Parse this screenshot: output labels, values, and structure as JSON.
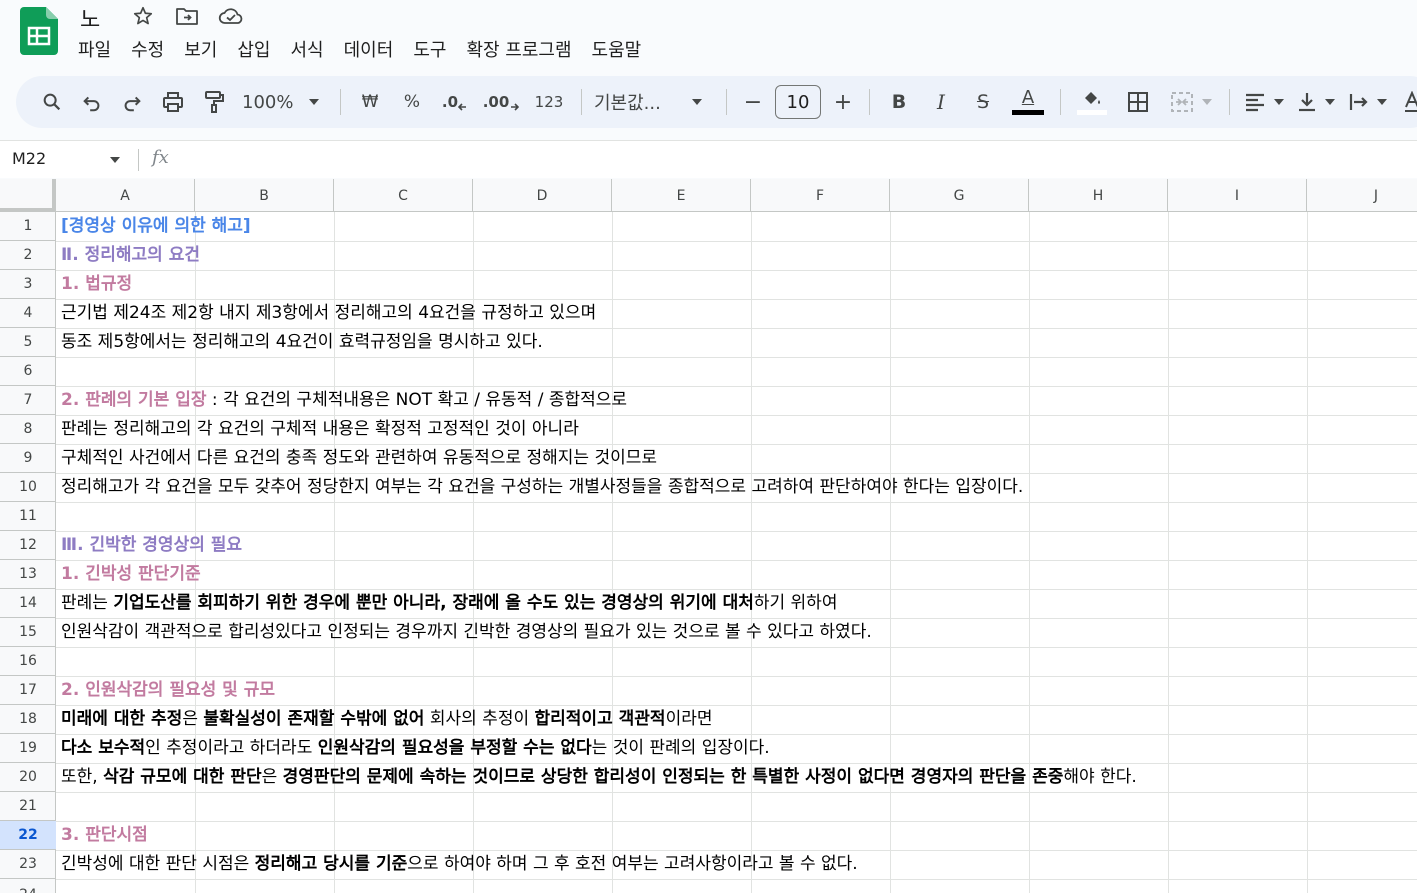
{
  "title_bar": {
    "doc_title": "노"
  },
  "menu": [
    "파일",
    "수정",
    "보기",
    "삽입",
    "서식",
    "데이터",
    "도구",
    "확장 프로그램",
    "도움말"
  ],
  "toolbar": {
    "zoom": "100%",
    "currency": "₩",
    "percent": "%",
    "decrease_decimal": ".0",
    "increase_decimal": ".00",
    "number_format": "123",
    "font_name": "기본값...",
    "font_size": "10",
    "minus": "−",
    "plus": "+",
    "bold": "B",
    "italic": "I",
    "strike": "S",
    "text_color": "A",
    "text_color_hex": "#000000"
  },
  "formula_bar": {
    "cell_ref": "M22",
    "fx": "fx"
  },
  "columns": [
    "A",
    "B",
    "C",
    "D",
    "E",
    "F",
    "G",
    "H",
    "I",
    "J"
  ],
  "rows": [
    "1",
    "2",
    "3",
    "4",
    "5",
    "6",
    "7",
    "8",
    "9",
    "10",
    "11",
    "12",
    "13",
    "14",
    "15",
    "16",
    "17",
    "18",
    "19",
    "20",
    "21",
    "22",
    "23",
    "24"
  ],
  "selected_row": "22",
  "colors": {
    "blue": "#4a86e8",
    "purple": "#8e7cc3",
    "pink": "#c27ba0",
    "accent": "#0b57d0"
  },
  "cells": {
    "r1": "[경영상 이유에 의한 해고]",
    "r2": "Ⅱ. 정리해고의 요건",
    "r3": "1. 법규정",
    "r4": "근기법 제24조 제2항 내지 제3항에서 정리해고의 4요건을 규정하고 있으며",
    "r5": "동조 제5항에서는 정리해고의 4요건이 효력규정임을 명시하고 있다.",
    "r7a": "2. 판례의 기본 입장",
    "r7b": " : 각 요건의 구체적내용은 NOT 확고 / 유동적 / 종합적으로",
    "r8": "판례는 정리해고의 각 요건의 구체적 내용은 확정적 고정적인 것이 아니라",
    "r9": "구체적인 사건에서 다른 요건의 충족 정도와 관련하여 유동적으로 정해지는 것이므로",
    "r10": "정리해고가 각 요건을 모두 갖추어 정당한지 여부는 각 요건을 구성하는 개별사정들을 종합적으로 고려하여 판단하여야 한다는 입장이다.",
    "r12": "Ⅲ. 긴박한 경영상의 필요",
    "r13": "1. 긴박성 판단기준",
    "r14a": "판례는 ",
    "r14b": "기업도산를 회피하기 위한 경우에 뿐만 아니라, 장래에 올 수도 있는 경영상의 위기에 대처",
    "r14c": "하기 위하여",
    "r15": "인원삭감이 객관적으로 합리성있다고 인정되는 경우까지 긴박한 경영상의 필요가 있는 것으로 볼 수 있다고 하였다.",
    "r17": "2. 인원삭감의 필요성 및 규모",
    "r18a": "미래에 대한 추정",
    "r18b": "은 ",
    "r18c": "불확실성이 존재할 수밖에 없어",
    "r18d": " 회사의 추정이 ",
    "r18e": "합리적이고 객관적",
    "r18f": "이라면",
    "r19a": "다소 보수적",
    "r19b": "인 추정이라고 하더라도 ",
    "r19c": "인원삭감의 필요성을 부정할 수는 없다",
    "r19d": "는 것이 판례의 입장이다.",
    "r20a": "또한, ",
    "r20b": "삭감 규모에 대한 판단",
    "r20c": "은 ",
    "r20d": "경영판단의 문제에 속하는 것이므로 상당한 합리성이 인정되는 한 특별한 사정이 없다면 경영자의 판단을 존중",
    "r20e": "해야 한다.",
    "r22": "3.  판단시점",
    "r23a": "긴박성에 대한 판단 시점은 ",
    "r23b": "정리해고 당시를 기준",
    "r23c": "으로 하여야 하며 그 후 호전 여부는 고려사항이라고 볼 수 없다."
  }
}
